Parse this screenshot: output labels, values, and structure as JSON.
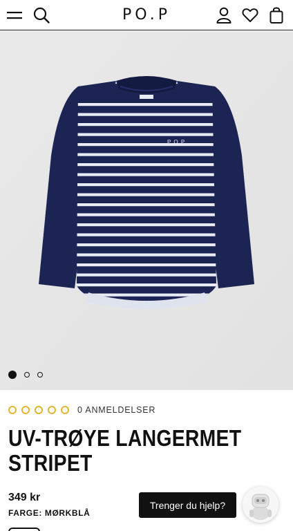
{
  "header": {
    "logo": "PO.P",
    "icons": [
      "menu-icon",
      "search-icon",
      "account-icon",
      "heart-icon",
      "bag-icon"
    ]
  },
  "gallery": {
    "slides_total": 3,
    "active_slide": 1,
    "background": "#e6e6e6"
  },
  "rating": {
    "stars_filled": 0,
    "stars_total": 5,
    "reviews_label": "0 ANMELDELSER",
    "star_color": "#e2b52d"
  },
  "product": {
    "title_line1": "UV-TRØYE LANGERMET",
    "title_line2": "STRIPET",
    "price": "349 kr",
    "color_label": "FARGE: MØRKBLÅ",
    "garment_color": "#1b2452",
    "stripe_color": "#e9ecf4"
  },
  "help": {
    "button_label": "Trenger du hjelp?"
  }
}
